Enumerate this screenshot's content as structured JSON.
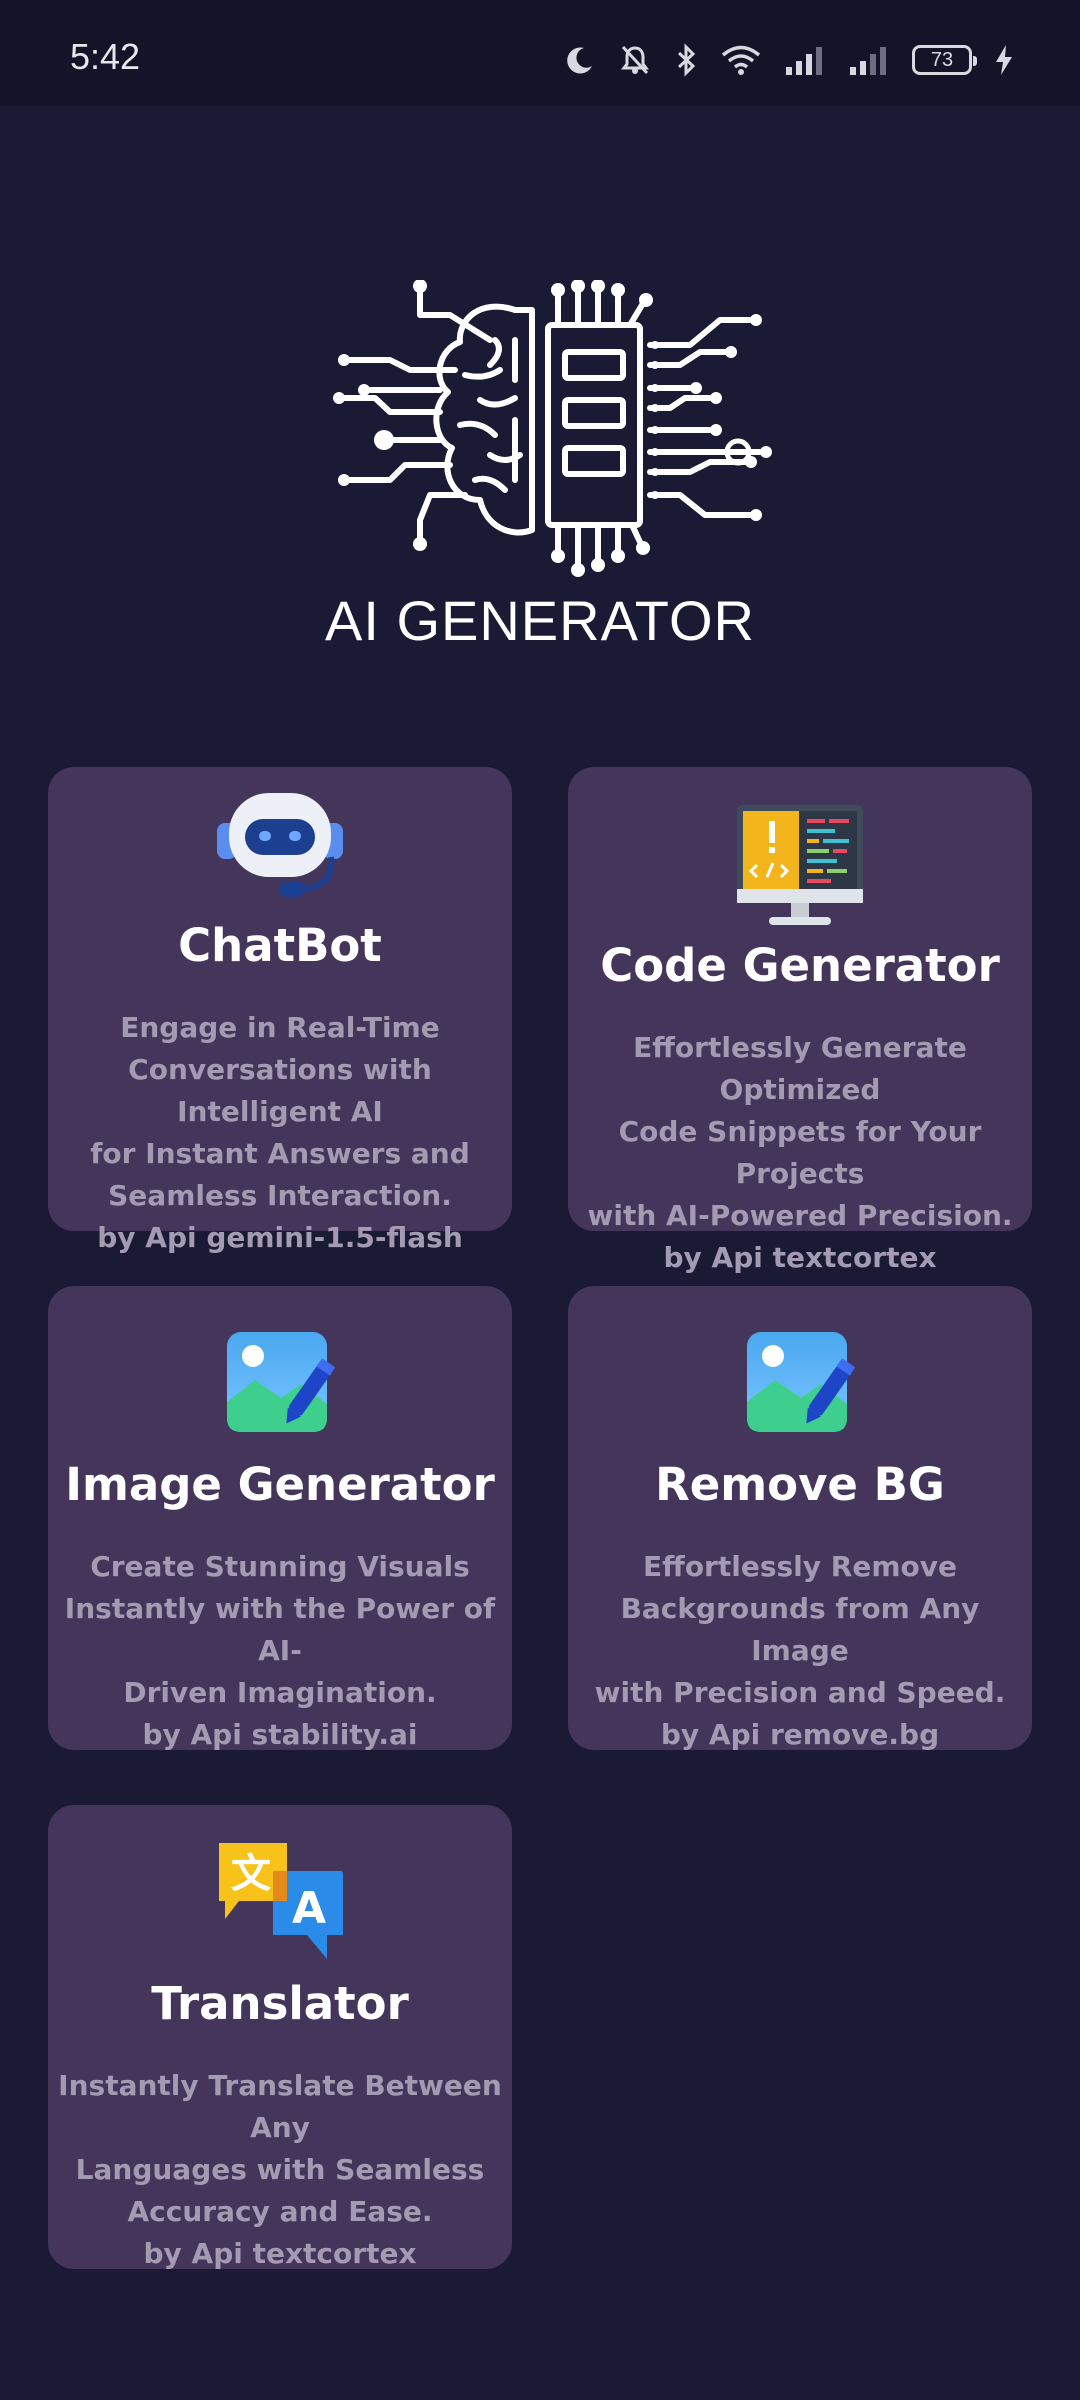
{
  "status_bar": {
    "time": "5:42",
    "battery": "73",
    "icons": [
      "moon-icon",
      "bell-off-icon",
      "bluetooth-icon",
      "wifi-icon",
      "signal-icon",
      "signal-icon",
      "battery-icon",
      "charging-icon"
    ]
  },
  "logo": {
    "text": "AI GENERATOR",
    "icon": "brain-circuit-icon"
  },
  "cards": [
    {
      "title": "ChatBot",
      "icon": "robot-icon",
      "description": "Engage in Real-Time\nConversations with Intelligent AI\nfor Instant Answers and\nSeamless Interaction.\nby Api gemini-1.5-flash"
    },
    {
      "title": "Code Generator",
      "icon": "code-monitor-icon",
      "description": "Effortlessly Generate Optimized\nCode Snippets for Your Projects\nwith AI-Powered Precision.\nby Api textcortex"
    },
    {
      "title": "Image Generator",
      "icon": "image-edit-icon",
      "description": "Create Stunning Visuals\nInstantly with the Power of AI-\nDriven Imagination.\nby Api stability.ai"
    },
    {
      "title": "Remove BG",
      "icon": "image-edit-icon",
      "description": "Effortlessly Remove\nBackgrounds from Any Image\nwith Precision and Speed.\nby Api remove.bg"
    },
    {
      "title": "Translator",
      "icon": "translate-icon",
      "description": "Instantly Translate Between Any\nLanguages with Seamless\nAccuracy and Ease.\nby Api textcortex"
    }
  ],
  "colors": {
    "background": "#1a1a35",
    "card": "#44355a",
    "title": "#ffffff",
    "description": "#a39bb2"
  }
}
